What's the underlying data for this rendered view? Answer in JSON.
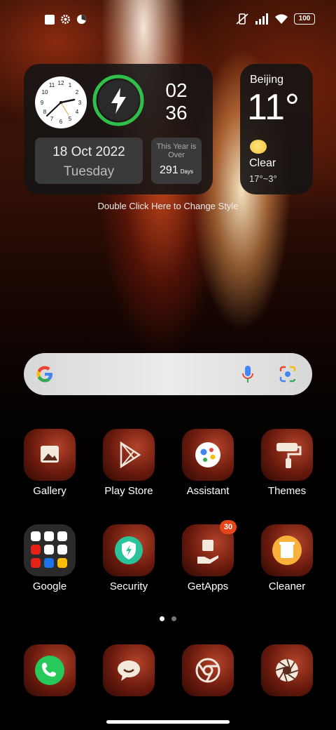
{
  "status_bar": {
    "left_icons": [
      "square-notification-icon",
      "gear-icon",
      "pie-icon"
    ],
    "right_icons": [
      "vibrate-off-icon",
      "signal-icon",
      "wifi-icon"
    ],
    "battery": "100"
  },
  "clock_widget": {
    "hour": "02",
    "minute": "36",
    "date": "18 Oct 2022",
    "weekday": "Tuesday",
    "year_label": "This Year is Over",
    "days_remaining": "291",
    "days_unit": "Days"
  },
  "weather_widget": {
    "city": "Beijing",
    "temperature": "11°",
    "condition": "Clear",
    "range": "17°~3°"
  },
  "hint_text": "Double Click Here to Change Style",
  "apps_row1": [
    {
      "label": "Gallery"
    },
    {
      "label": "Play Store"
    },
    {
      "label": "Assistant"
    },
    {
      "label": "Themes"
    }
  ],
  "apps_row2": [
    {
      "label": "Google"
    },
    {
      "label": "Security"
    },
    {
      "label": "GetApps",
      "badge": "30"
    },
    {
      "label": "Cleaner"
    }
  ],
  "dock": [
    "phone-icon",
    "messages-icon",
    "chrome-icon",
    "camera-icon"
  ],
  "page_indicator": {
    "pages": 2,
    "active": 1
  }
}
